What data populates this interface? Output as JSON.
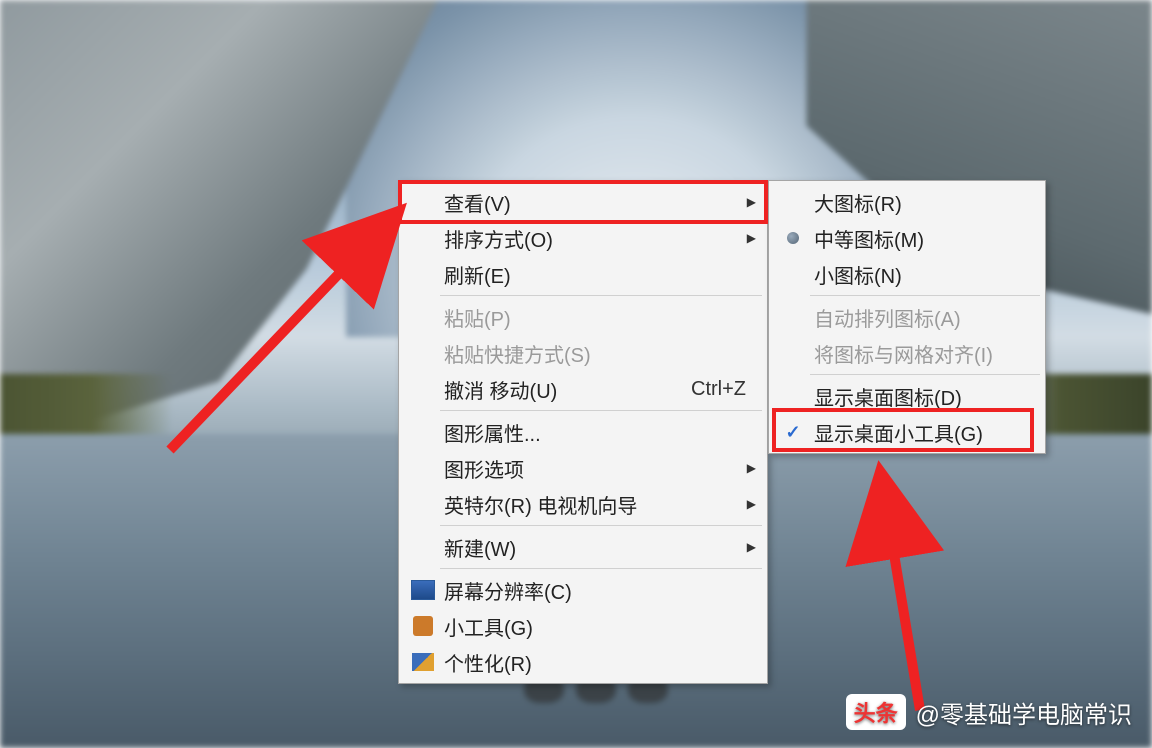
{
  "main_menu": {
    "view": {
      "label": "查看(V)",
      "has_submenu": true,
      "highlighted": true
    },
    "sort": {
      "label": "排序方式(O)",
      "has_submenu": true
    },
    "refresh": {
      "label": "刷新(E)"
    },
    "paste": {
      "label": "粘贴(P)",
      "disabled": true
    },
    "paste_shortcut": {
      "label": "粘贴快捷方式(S)",
      "disabled": true
    },
    "undo": {
      "label": "撤消 移动(U)",
      "shortcut": "Ctrl+Z"
    },
    "graphics_props": {
      "label": "图形属性..."
    },
    "graphics_options": {
      "label": "图形选项",
      "has_submenu": true
    },
    "intel_tv": {
      "label": "英特尔(R) 电视机向导",
      "has_submenu": true
    },
    "new": {
      "label": "新建(W)",
      "has_submenu": true
    },
    "screen_res": {
      "label": "屏幕分辨率(C)"
    },
    "gadgets": {
      "label": "小工具(G)"
    },
    "personalize": {
      "label": "个性化(R)"
    }
  },
  "sub_menu": {
    "large_icons": {
      "label": "大图标(R)"
    },
    "medium_icons": {
      "label": "中等图标(M)",
      "selected": true
    },
    "small_icons": {
      "label": "小图标(N)"
    },
    "auto_arrange": {
      "label": "自动排列图标(A)",
      "disabled": true
    },
    "align_grid": {
      "label": "将图标与网格对齐(I)",
      "disabled": true
    },
    "show_desktop_icons": {
      "label": "显示桌面图标(D)",
      "highlighted": true
    },
    "show_gadgets": {
      "label": "显示桌面小工具(G)",
      "checked": true
    }
  },
  "watermark": {
    "badge": "头条",
    "text": "@零基础学电脑常识"
  },
  "annotation_color": "#e22"
}
